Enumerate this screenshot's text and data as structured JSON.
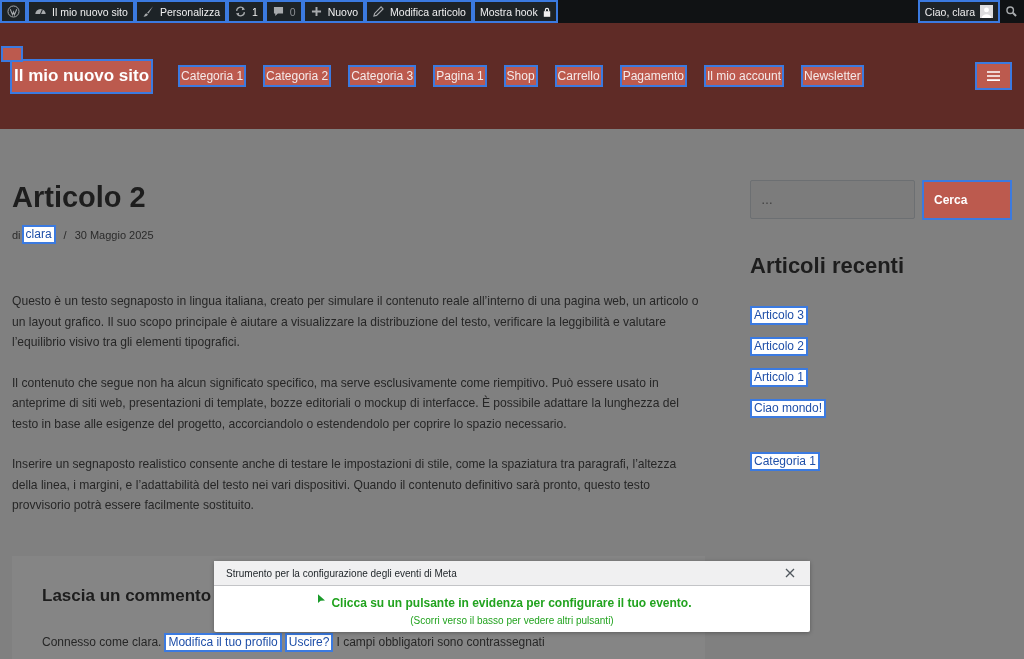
{
  "admin_bar": {
    "items": [
      {
        "highlighted": true
      },
      {
        "label": "Il mio nuovo sito",
        "highlighted": true
      },
      {
        "label": "Personalizza",
        "highlighted": true
      },
      {
        "label": "1",
        "highlighted": true
      },
      {
        "label": "0",
        "highlighted": true
      },
      {
        "label": "Nuovo",
        "highlighted": true
      },
      {
        "label": "Modifica articolo",
        "highlighted": true
      },
      {
        "label": "Mostra hook",
        "highlighted": true
      }
    ],
    "account": {
      "label": "Ciao, clara",
      "highlighted": true
    }
  },
  "header": {
    "skip_button": {
      "highlighted": true
    },
    "site_title": {
      "label": "Il mio nuovo sito",
      "highlighted": true
    },
    "nav": [
      {
        "label": "Categoria 1",
        "highlighted": true
      },
      {
        "label": "Categoria 2",
        "highlighted": true
      },
      {
        "label": "Categoria 3",
        "highlighted": true
      },
      {
        "label": "Pagina 1",
        "highlighted": true
      },
      {
        "label": "Shop",
        "highlighted": true
      },
      {
        "label": "Carrello",
        "highlighted": true
      },
      {
        "label": "Pagamento",
        "highlighted": true
      },
      {
        "label": "Il mio account",
        "highlighted": true
      },
      {
        "label": "Newsletter",
        "highlighted": true
      }
    ],
    "menu_button": {
      "highlighted": true
    }
  },
  "article": {
    "title": "Articolo 2",
    "byline": "di",
    "author": {
      "label": "clara",
      "highlighted": true
    },
    "separator": "/",
    "date": "30 Maggio 2025",
    "paragraphs": [
      "Questo è un testo segnaposto in lingua italiana, creato per simulare il contenuto reale all’interno di una pagina web, un articolo o un layout grafico. Il suo scopo principale è aiutare a visualizzare la distribuzione del testo, verificare la leggibilità e valutare l’equilibrio visivo tra gli elementi tipografici.",
      "Il contenuto che segue non ha alcun significato specifico, ma serve esclusivamente come riempitivo. Può essere usato in anteprime di siti web, presentazioni di template, bozze editoriali o mockup di interfacce. È possibile adattare la lunghezza del testo in base alle esigenze del progetto, accorciandolo o estendendolo per coprire lo spazio necessario.",
      "Inserire un segnaposto realistico consente anche di testare le impostazioni di stile, come la spaziatura tra paragrafi, l’altezza della linea, i margini, e l’adattabilità del testo nei vari dispositivi. Quando il contenuto definitivo sarà pronto, questo testo provvisorio potrà essere facilmente sostituito."
    ]
  },
  "comments": {
    "title": "Lascia un commento",
    "logged_in": "Connesso come clara.",
    "profile_link": {
      "label": "Modifica il tuo profilo",
      "highlighted": true
    },
    "logout_link": {
      "label": "Uscire?",
      "highlighted": true
    },
    "required_note": "I campi obbligatori sono contrassegnati"
  },
  "sidebar": {
    "search": {
      "placeholder": "…",
      "button": {
        "label": "Cerca",
        "highlighted": true
      }
    },
    "recent_title": "Articoli recenti",
    "recent": [
      {
        "label": "Articolo 3",
        "highlighted": true
      },
      {
        "label": "Articolo 2",
        "highlighted": true
      },
      {
        "label": "Articolo 1",
        "highlighted": true
      },
      {
        "label": "Ciao mondo!",
        "highlighted": true
      }
    ],
    "categories": [
      {
        "label": "Categoria 1",
        "highlighted": true
      }
    ]
  },
  "dialog": {
    "title": "Strumento per la configurazione degli eventi di Meta",
    "message": "Clicca su un pulsante in evidenza per configurare il tuo evento.",
    "hint": "(Scorri verso il basso per vedere altri pulsanti)"
  }
}
